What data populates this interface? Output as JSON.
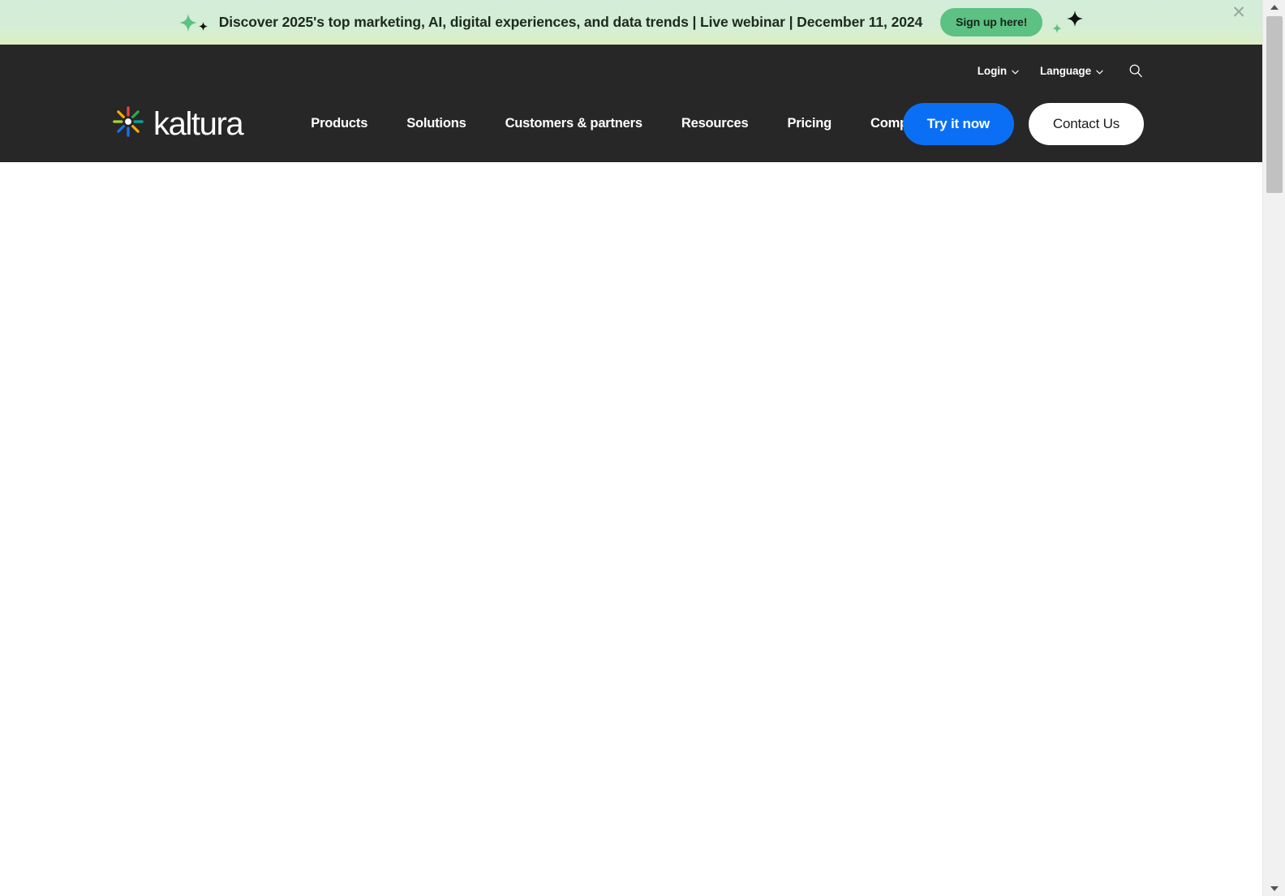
{
  "promo": {
    "text": "Discover 2025's top marketing, AI, digital experiences, and data trends | Live webinar | December 11, 2024",
    "cta_label": "Sign up here!",
    "close_label": "✕",
    "bg_start": "#d2edd9",
    "bg_end": "#dcefc5",
    "cta_color": "#5cc183",
    "sparkle_green": "#5cc183",
    "sparkle_black": "#111111"
  },
  "header": {
    "bg": "#272727",
    "logo": {
      "wordmark": "kaltura",
      "ray_colors": [
        "#e8453c",
        "#34a853",
        "#00a79d",
        "#f9ab00",
        "#1a73e8",
        "#1a73e8",
        "#f9ab00",
        "#aed136"
      ]
    },
    "utility": [
      {
        "label": "Login",
        "icon": "chevron-down-icon"
      },
      {
        "label": "Language",
        "icon": "chevron-down-icon"
      }
    ],
    "search_icon": "search-icon",
    "nav": [
      {
        "label": "Products"
      },
      {
        "label": "Solutions"
      },
      {
        "label": "Customers & partners"
      },
      {
        "label": "Resources"
      },
      {
        "label": "Pricing"
      },
      {
        "label": "Company"
      }
    ],
    "ctas": {
      "try_label": "Try it now",
      "try_color": "#0a6ff5",
      "contact_label": "Contact Us",
      "contact_color": "#ffffff"
    }
  },
  "scrollbar": {
    "up_icon": "scroll-up-arrow-icon",
    "down_icon": "scroll-down-arrow-icon",
    "track_color": "#f1f1f1",
    "thumb_color": "#c1c1c1"
  }
}
